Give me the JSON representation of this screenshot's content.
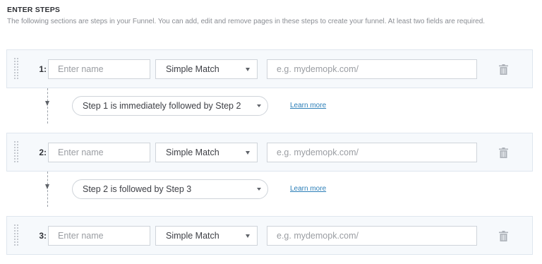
{
  "header": {
    "title": "ENTER STEPS",
    "description": "The following sections are steps in your Funnel. You can add, edit and remove pages in these steps to create your funnel. At least two fields are required."
  },
  "steps": [
    {
      "number": "1:",
      "name_placeholder": "Enter name",
      "match_type": "Simple Match",
      "url_placeholder": "e.g. mydemopk.com/"
    },
    {
      "number": "2:",
      "name_placeholder": "Enter name",
      "match_type": "Simple Match",
      "url_placeholder": "e.g. mydemopk.com/"
    },
    {
      "number": "3:",
      "name_placeholder": "Enter name",
      "match_type": "Simple Match",
      "url_placeholder": "e.g. mydemopk.com/"
    }
  ],
  "connectors": [
    {
      "relation": "Step 1 is immediately followed by Step 2",
      "learn_more": "Learn more"
    },
    {
      "relation": "Step 2 is followed by Step 3",
      "learn_more": "Learn more"
    }
  ],
  "icons": {
    "drag": "drag-handle-icon",
    "delete": "trash-icon",
    "dropdown": "caret-down-icon",
    "flow": "arrow-down-icon"
  },
  "colors": {
    "link": "#2d7fb8",
    "step_bg": "#f6f9fc",
    "border": "#dfe6ee"
  }
}
